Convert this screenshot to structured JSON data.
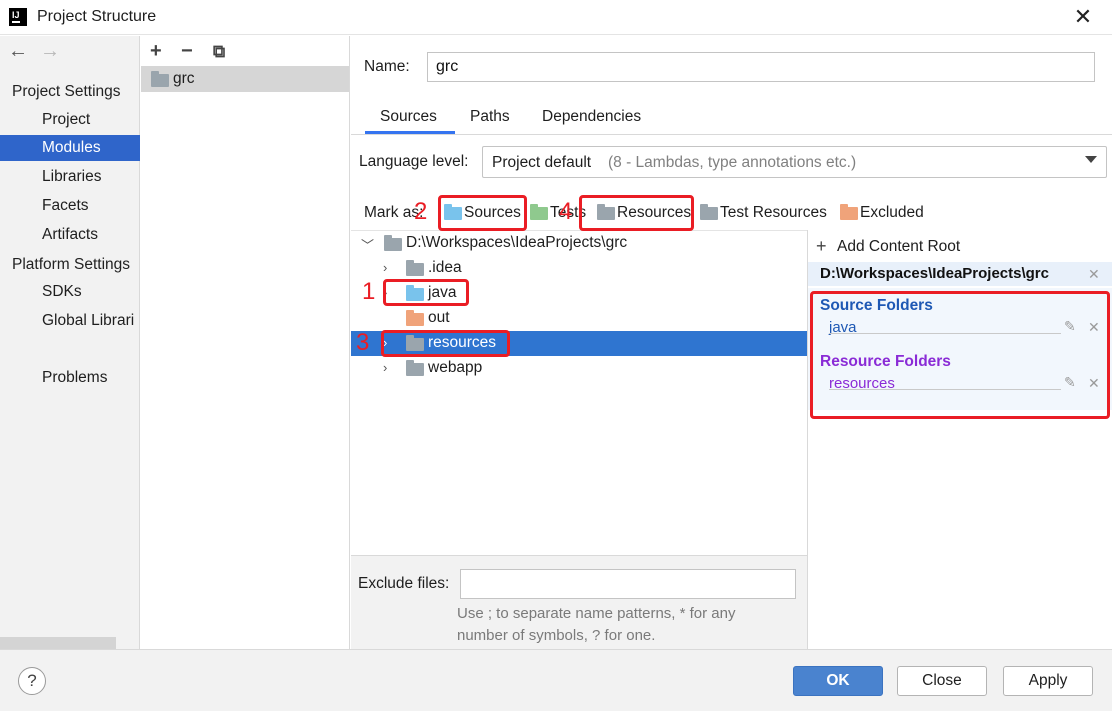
{
  "window": {
    "title": "Project Structure",
    "app_icon_text": "IJ",
    "close_glyph": "✕"
  },
  "nav": {
    "back": "←",
    "forward": "→",
    "project_settings_heading": "Project Settings",
    "project_settings_items": [
      "Project",
      "Modules",
      "Libraries",
      "Facets",
      "Artifacts"
    ],
    "selected_item": "Modules",
    "platform_settings_heading": "Platform Settings",
    "platform_settings_items": [
      "SDKs",
      "Global Librari"
    ],
    "problems": "Problems"
  },
  "module_list": {
    "toolbar": {
      "add": "+",
      "remove": "−",
      "copy": "⧉"
    },
    "modules": [
      "grc"
    ]
  },
  "module": {
    "name_label": "Name:",
    "name_value": "grc",
    "tabs": [
      "Sources",
      "Paths",
      "Dependencies"
    ],
    "active_tab": "Sources",
    "language_level_label": "Language level:",
    "language_level_value": "Project default",
    "language_level_hint": "(8 - Lambdas, type annotations etc.)",
    "mark_as_label": "Mark as:",
    "mark_as_buttons": [
      "Sources",
      "Tests",
      "Resources",
      "Test Resources",
      "Excluded"
    ]
  },
  "tree": {
    "root": "D:\\Workspaces\\IdeaProjects\\grc",
    "children": [
      ".idea",
      "java",
      "out",
      "resources",
      "webapp"
    ],
    "selected": "resources"
  },
  "exclude": {
    "label": "Exclude files:",
    "value": "",
    "hint_line1": "Use ; to separate name patterns, * for any",
    "hint_line2": "number of symbols, ? for one."
  },
  "content_root": {
    "add_label": "Add Content Root",
    "path": "D:\\Workspaces\\IdeaProjects\\grc",
    "source_folders_title": "Source Folders",
    "source_folders": [
      "java"
    ],
    "resource_folders_title": "Resource Folders",
    "resource_folders": [
      "resources"
    ],
    "edit_glyph": "✎",
    "remove_glyph": "✕"
  },
  "annotations": {
    "labels": [
      "1",
      "2",
      "3",
      "4"
    ],
    "color": "#ea1d24"
  },
  "buttons": {
    "help": "?",
    "ok": "OK",
    "close": "Close",
    "apply": "Apply"
  },
  "colors": {
    "selection": "#2f65ca",
    "tree_selection": "#2f75d0",
    "source": "#1e58b4",
    "resource": "#8a2bd6",
    "primary_button": "#4a83cf"
  }
}
